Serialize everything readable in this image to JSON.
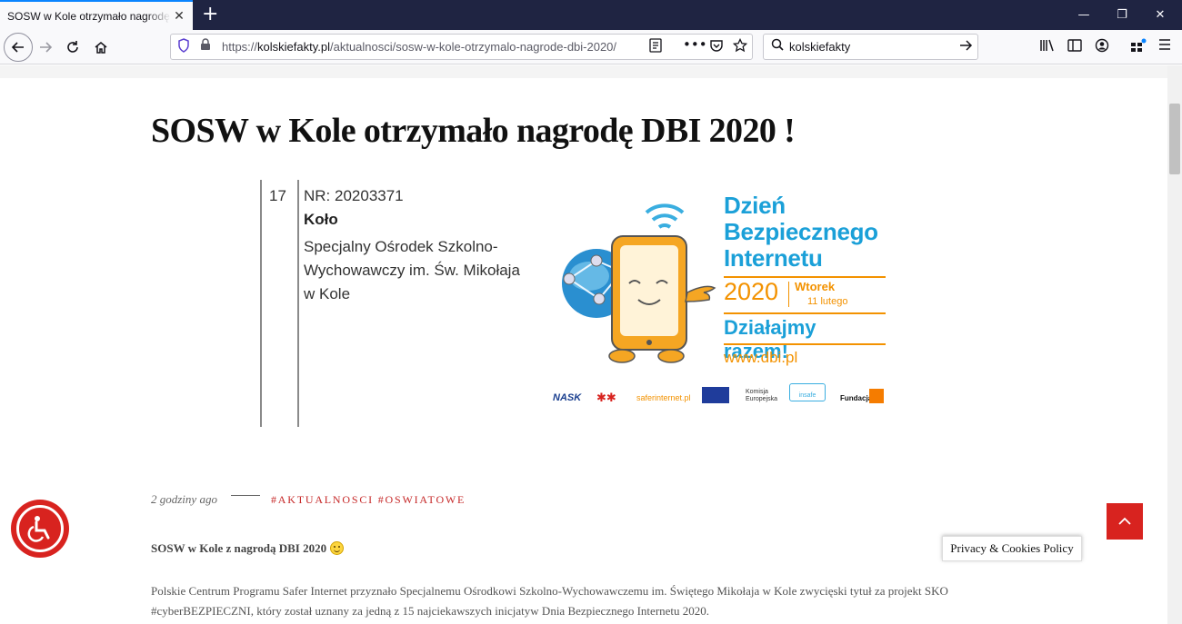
{
  "browser": {
    "tab_title": "SOSW w Kole otrzymało nagrodę DBI 2020 !",
    "url_prefix": "https://",
    "url_domain": "kolskiefakty.pl",
    "url_path": "/aktualnosci/sosw-w-kole-otrzymalo-nagrode-dbi-2020/",
    "search_value": "kolskiefakty",
    "icons": [
      "back-icon",
      "forward-icon",
      "reload-icon",
      "home-icon",
      "shield-icon",
      "lock-icon",
      "reader-view-icon",
      "more-icon",
      "pocket-icon",
      "bookmark-star-icon",
      "search-icon",
      "go-arrow-icon",
      "library-icon",
      "sidebar-icon",
      "account-icon",
      "extensions-icon",
      "menu-icon"
    ]
  },
  "article": {
    "title": "SOSW w Kole otrzymało nagrodę DBI 2020 !",
    "hero": {
      "number": "17",
      "nr": "NR: 20203371",
      "city": "Koło",
      "school": "Specjalny Ośrodek Szkolno-Wychowawczy im. Św. Mikołaja w Kole",
      "dbi_title_1": "Dzień",
      "dbi_title_2": "Bezpiecznego",
      "dbi_title_3": "Internetu",
      "year": "2020",
      "day": "Wtorek",
      "date": "11 lutego",
      "slogan": "Działajmy razem!",
      "url": "www.dbi.pl",
      "sponsors": [
        "NASK",
        "saferinternet.pl",
        "Komisja Europejska",
        "insafe",
        "Fundacja"
      ]
    },
    "meta": {
      "date": "2 godziny ago",
      "tags": "#AKTUALNOSCI #OSWIATOWE"
    },
    "lead": "SOSW w Kole z nagrodą DBI 2020",
    "paragraph": "Polskie Centrum Programu Safer Internet przyznało Specjalnemu Ośrodkowi Szkolno-Wychowawczemu im. Świętego Mikołaja w Kole zwycięski tytuł za projekt SKO #cyberBEZPIECZNI, który został uznany za jedną z 15 najciekawszych inicjatyw Dnia Bezpiecznego Internetu 2020."
  },
  "overlays": {
    "privacy_label": "Privacy & Cookies Policy"
  },
  "colors": {
    "accent_red": "#d8231f",
    "dbi_blue": "#1ba0d8",
    "dbi_orange": "#f39200",
    "tag_red": "#c62828"
  }
}
